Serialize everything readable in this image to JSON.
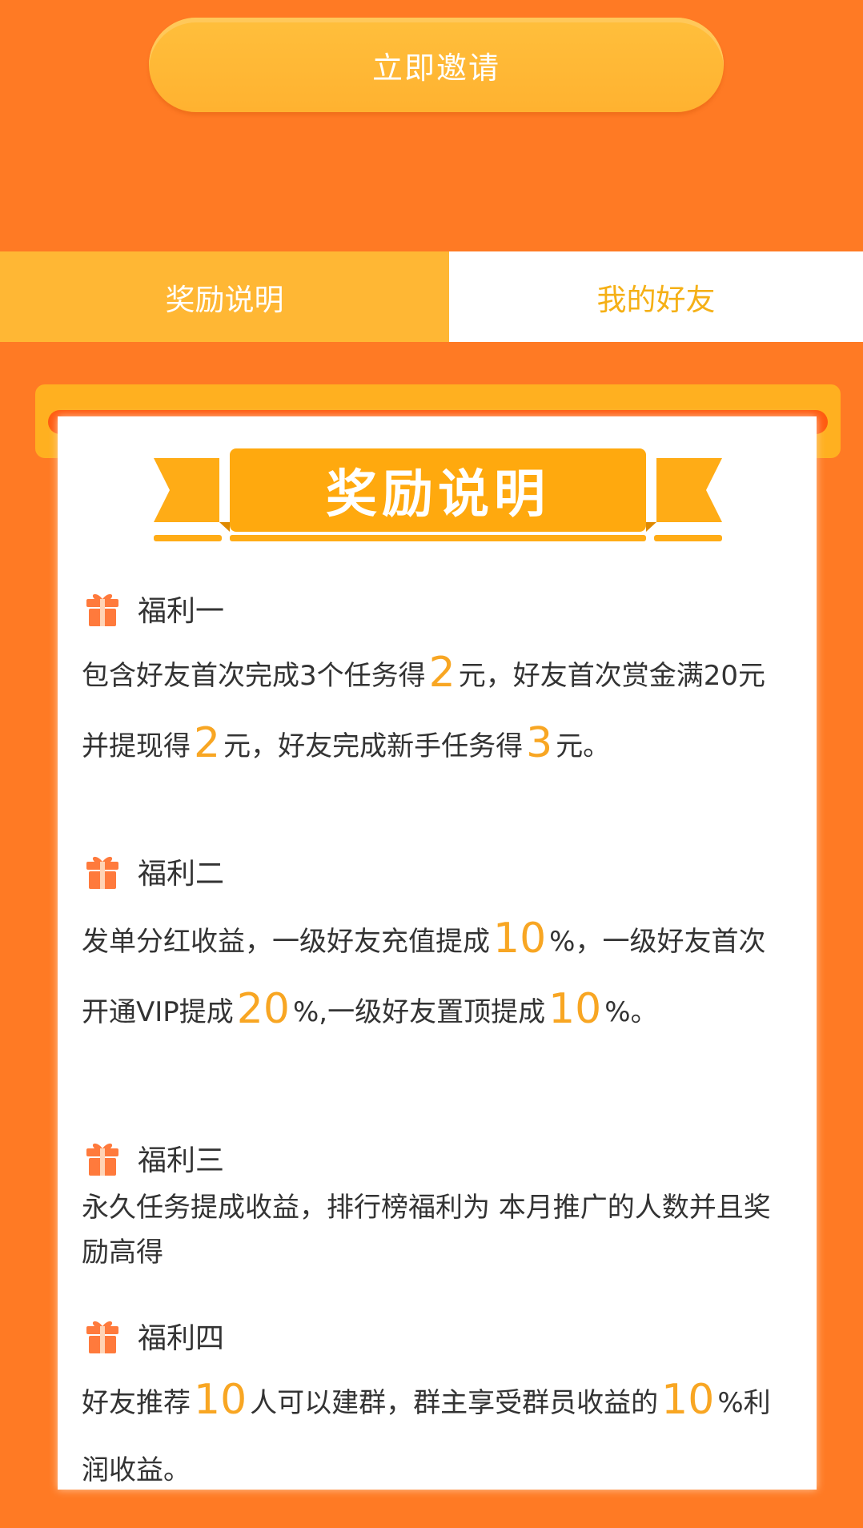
{
  "invite_button": {
    "label": "立即邀请"
  },
  "tabs": [
    {
      "label": "奖励说明",
      "active": true
    },
    {
      "label": "我的好友",
      "active": false
    }
  ],
  "panel": {
    "title": "奖励说明"
  },
  "benefits": [
    {
      "title": "福利一",
      "parts": [
        "包含好友首次完成3个任务得",
        "2",
        "元，好友首次赏金满20元并提现得",
        "2",
        "元，好友完成新手任务得",
        "3",
        "元。"
      ]
    },
    {
      "title": "福利二",
      "parts": [
        "发单分红收益，一级好友充值提成",
        "10",
        "%，一级好友首次开通VIP提成",
        "20",
        "%,一级好友置顶提成",
        "10",
        "%。"
      ]
    },
    {
      "title": "福利三",
      "text": "永久任务提成收益，排行榜福利为 本月推广的人数并且奖励高得"
    },
    {
      "title": "福利四",
      "parts": [
        "好友推荐",
        "10",
        "人可以建群，群主享受群员收益的",
        "10",
        "%利润收益。"
      ]
    }
  ],
  "colors": {
    "background": "#ff7a24",
    "button": "#ffb734",
    "highlight": "#f8a623",
    "tab_inactive_text": "#f5b016"
  }
}
